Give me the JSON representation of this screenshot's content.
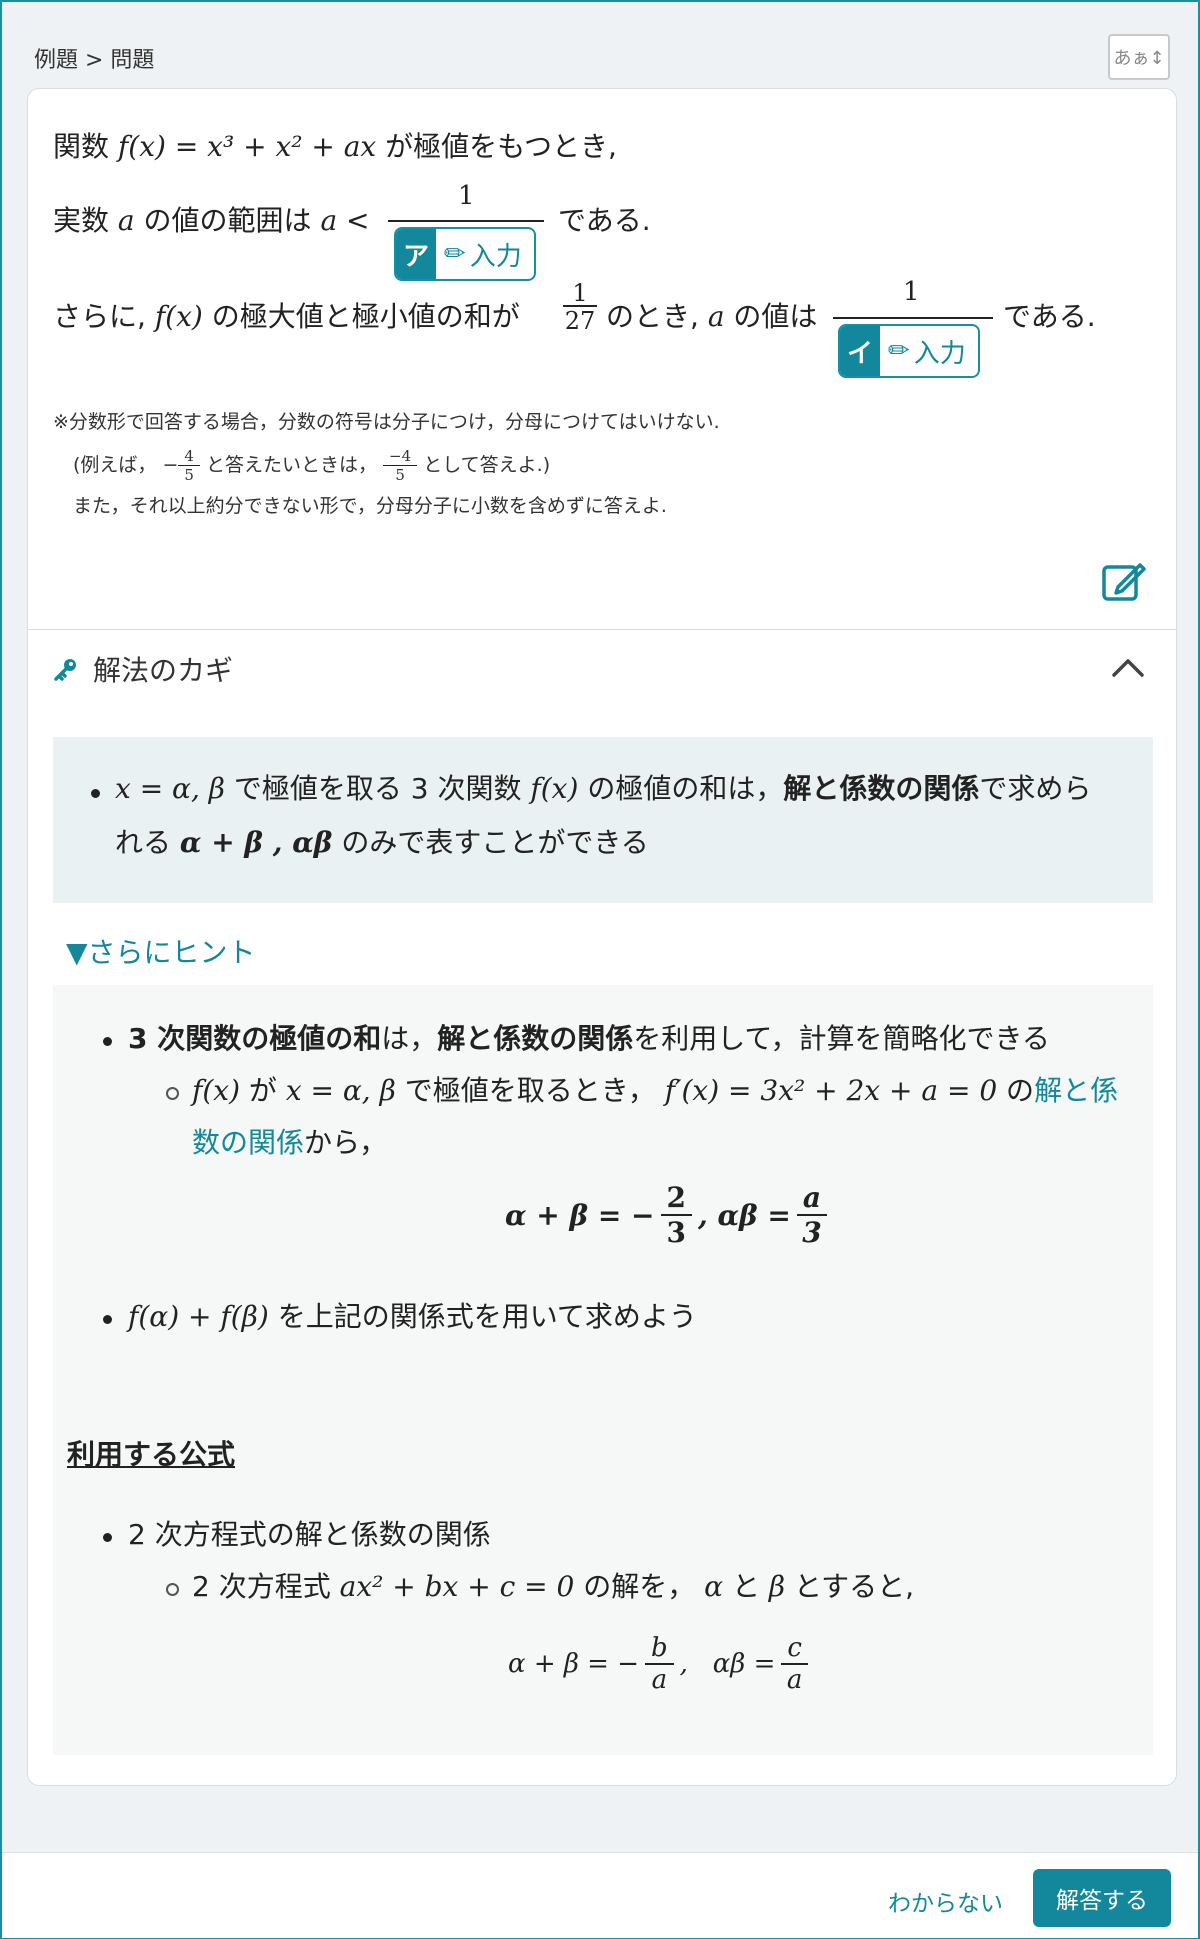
{
  "breadcrumb": "例題 > 問題",
  "size_toggle": "あぁ↕",
  "question": {
    "line1_a": "関数",
    "line1_math": "f(x) = x³ + x² + ax",
    "line1_b": "が極値をもつとき,",
    "line2_a": "実数",
    "line2_var": "a",
    "line2_b": "の値の範囲は",
    "line2_ineq": "a <",
    "line2_num": "1",
    "line2_c": "である.",
    "line3_a": "さらに,",
    "line3_fx": "f(x)",
    "line3_b": "の極大値と極小値の和が",
    "line3_frac_num": "1",
    "line3_frac_den": "27",
    "line3_c": "のとき,",
    "line3_var": "a",
    "line3_d": "の値は",
    "line3_num": "1",
    "line3_e": "である."
  },
  "answer_boxes": [
    {
      "label": "ア",
      "input_label": "入力"
    },
    {
      "label": "イ",
      "input_label": "入力"
    }
  ],
  "notes": {
    "n1": "※分数形で回答する場合，分数の符号は分子につけ，分母につけてはいけない.",
    "n2_a": "(例えば，",
    "n2_frac1_num": "4",
    "n2_frac1_den": "5",
    "n2_b": "と答えたいときは，",
    "n2_frac2_num": "−4",
    "n2_frac2_den": "5",
    "n2_c": "として答えよ.)",
    "n3": "また，それ以上約分できない形で，分母分子に小数を含めずに答えよ."
  },
  "key_section": {
    "title": "解法のカギ",
    "hint_a": "x = α, β",
    "hint_b": "で極値を取る 3 次関数",
    "hint_c": "f(x)",
    "hint_d": "の極値の和は，",
    "hint_bold": "解と係数の関係",
    "hint_e": "で求めら",
    "hint_line2_a": "れる",
    "hint_line2_math": "α + β , αβ",
    "hint_line2_b": "のみで表すことができる"
  },
  "more_hint": {
    "toggle": "▼さらにヒント",
    "b1_bold1": "3 次関数の極値の和",
    "b1_a": "は，",
    "b1_bold2": "解と係数の関係",
    "b1_b": "を利用して，計算を簡略化できる",
    "s1_a": "f(x)",
    "s1_b": "が",
    "s1_c": "x = α, β",
    "s1_d": "で極値を取るとき，",
    "s1_e": "f′(x) = 3x² + 2x + a = 0",
    "s1_f": "の",
    "s1_link1": "解と係",
    "s1_link2": "数の関係",
    "s1_g": "から，",
    "eq1": "α + β = −",
    "eq1_num": "2",
    "eq1_den": "3",
    "eq1_mid": ", αβ =",
    "eq1_num2": "a",
    "eq1_den2": "3",
    "b2_a": "f(α) + f(β)",
    "b2_b": "を上記の関係式を用いて求めよう",
    "formula_title": "利用する公式",
    "b3": "2 次方程式の解と係数の関係",
    "s3_a": "2 次方程式",
    "s3_b": "ax² + bx + c = 0",
    "s3_c": "の解を，",
    "s3_d": "α",
    "s3_e": "と",
    "s3_f": "β",
    "s3_g": "とすると,",
    "eq2_a": "α + β = −",
    "eq2_num": "b",
    "eq2_den": "a",
    "eq2_b": ",   αβ =",
    "eq2_num2": "c",
    "eq2_den2": "a"
  },
  "footer": {
    "dont_know": "わからない",
    "submit": "解答する"
  },
  "colors": {
    "accent": "#13879b",
    "frame": "#1392a6",
    "hint_bg": "#e9f1f3"
  }
}
